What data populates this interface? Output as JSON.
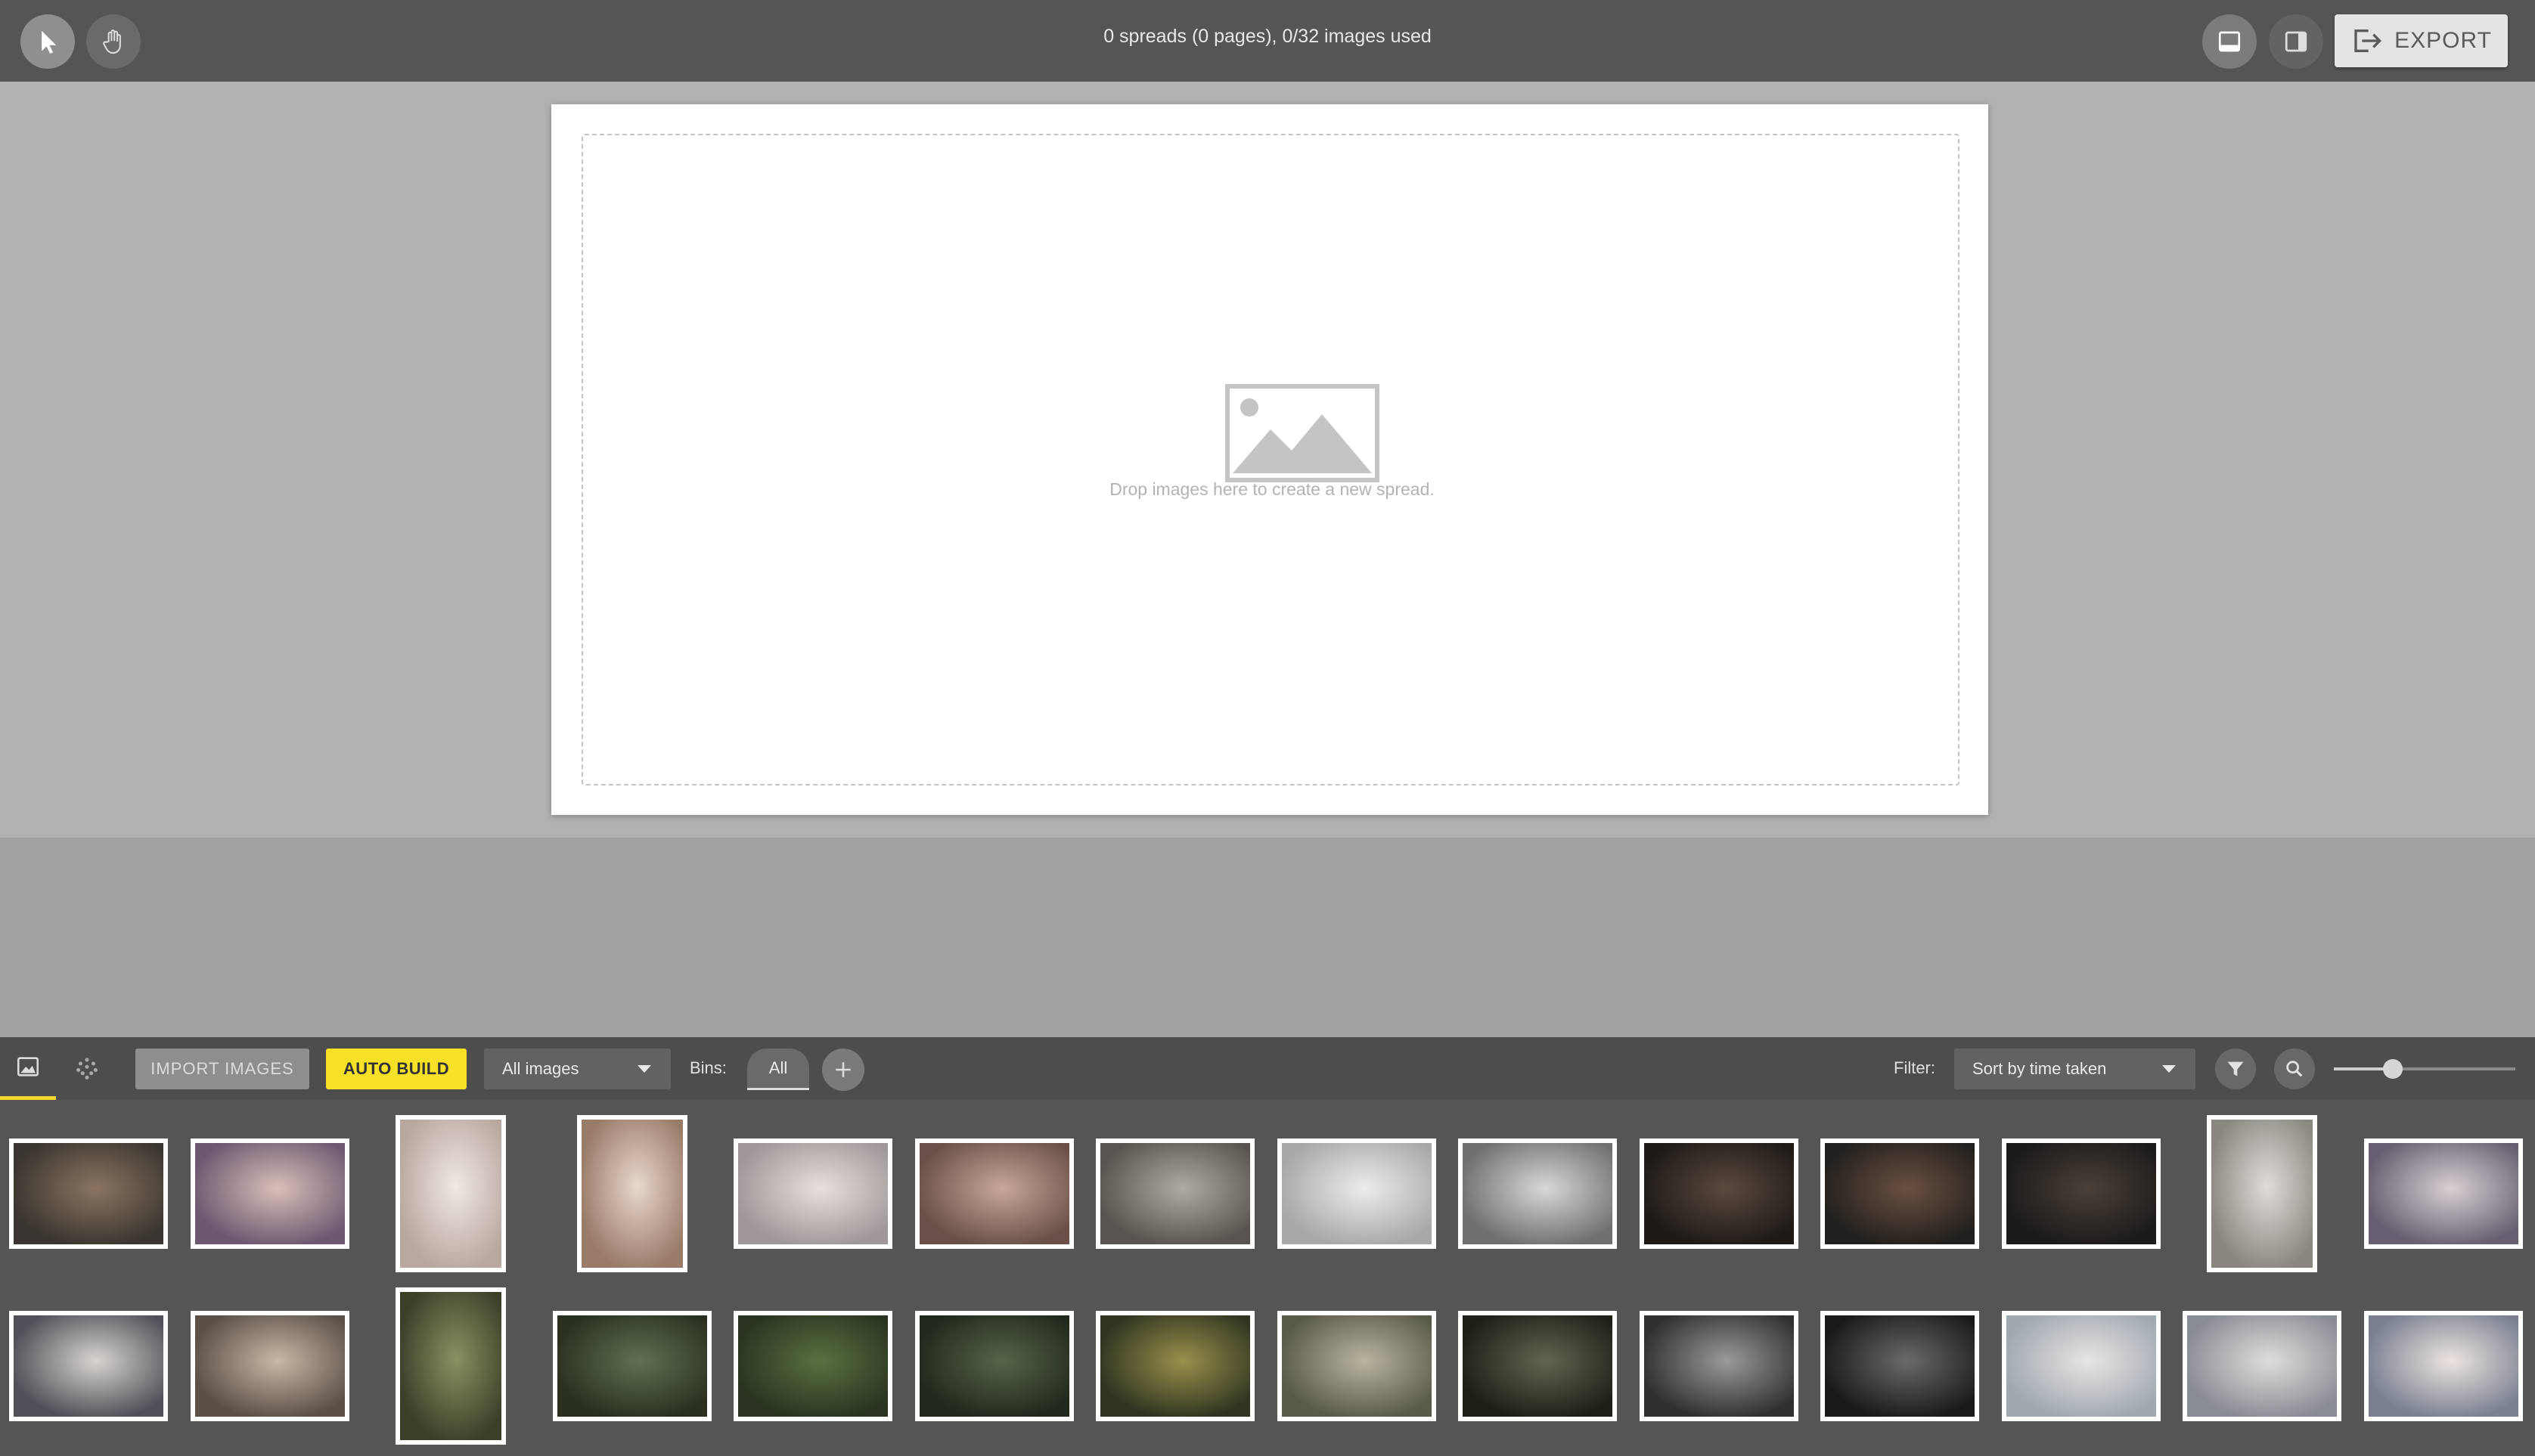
{
  "topbar": {
    "status": "0 spreads (0 pages), 0/32 images used",
    "export_label": "EXPORT",
    "tools": [
      "pointer-icon",
      "hand-icon"
    ],
    "view_icons": [
      "spread-view-icon",
      "split-view-icon"
    ]
  },
  "canvas": {
    "drop_text": "Drop images here to create a new spread."
  },
  "toolbar": {
    "import_label": "IMPORT IMAGES",
    "auto_build_label": "AUTO BUILD",
    "images_select": "All images",
    "bins_label": "Bins:",
    "bin_all": "All",
    "filter_label": "Filter:",
    "sort_select": "Sort by time taken",
    "accent": "#f6e126"
  },
  "thumbnails": {
    "row1": [
      {
        "tone": [
          "#3a3530",
          "#8a7560"
        ],
        "orientation": "landscape"
      },
      {
        "tone": [
          "#6e5870",
          "#d8c0b8"
        ],
        "orientation": "landscape"
      },
      {
        "tone": [
          "#b8a8a0",
          "#f0e8e4"
        ],
        "orientation": "portrait"
      },
      {
        "tone": [
          "#9a7a68",
          "#e8d8cc"
        ],
        "orientation": "portrait"
      },
      {
        "tone": [
          "#a09898",
          "#e8e0dc"
        ],
        "orientation": "landscape"
      },
      {
        "tone": [
          "#6a5048",
          "#c8a898"
        ],
        "orientation": "landscape"
      },
      {
        "tone": [
          "#5a5450",
          "#b0aaa4"
        ],
        "orientation": "landscape"
      },
      {
        "tone": [
          "#a8a8a8",
          "#ececec"
        ],
        "orientation": "landscape"
      },
      {
        "tone": [
          "#707070",
          "#d8d8d8"
        ],
        "orientation": "landscape"
      },
      {
        "tone": [
          "#1e1a18",
          "#5a4a3e"
        ],
        "orientation": "landscape"
      },
      {
        "tone": [
          "#22201e",
          "#6a5040"
        ],
        "orientation": "landscape"
      },
      {
        "tone": [
          "#1c1a1a",
          "#4a4038"
        ],
        "orientation": "landscape"
      },
      {
        "tone": [
          "#8a8680",
          "#e0dcd8"
        ],
        "orientation": "portrait"
      },
      {
        "tone": [
          "#686070",
          "#d8d0d4"
        ],
        "orientation": "landscape"
      }
    ],
    "row2": [
      {
        "tone": [
          "#505058",
          "#d8d4d0"
        ],
        "orientation": "landscape"
      },
      {
        "tone": [
          "#5a5048",
          "#c8b8a4"
        ],
        "orientation": "landscape"
      },
      {
        "tone": [
          "#3a4028",
          "#8a9060"
        ],
        "orientation": "portrait"
      },
      {
        "tone": [
          "#2a3020",
          "#607050"
        ],
        "orientation": "landscape"
      },
      {
        "tone": [
          "#2a3420",
          "#5a7040"
        ],
        "orientation": "landscape"
      },
      {
        "tone": [
          "#22281c",
          "#566448"
        ],
        "orientation": "landscape"
      },
      {
        "tone": [
          "#303420",
          "#98904c"
        ],
        "orientation": "landscape"
      },
      {
        "tone": [
          "#5a5a48",
          "#b8b4a0"
        ],
        "orientation": "landscape"
      },
      {
        "tone": [
          "#1e2018",
          "#646450"
        ],
        "orientation": "landscape"
      },
      {
        "tone": [
          "#303030",
          "#9a9a9a"
        ],
        "orientation": "landscape"
      },
      {
        "tone": [
          "#1a1a1a",
          "#6a6a6a"
        ],
        "orientation": "landscape"
      },
      {
        "tone": [
          "#a0a8b0",
          "#e8e4e4"
        ],
        "orientation": "landscape"
      },
      {
        "tone": [
          "#8a8c94",
          "#e0dcdc"
        ],
        "orientation": "landscape"
      },
      {
        "tone": [
          "#7a8090",
          "#ece4e0"
        ],
        "orientation": "landscape"
      }
    ]
  }
}
